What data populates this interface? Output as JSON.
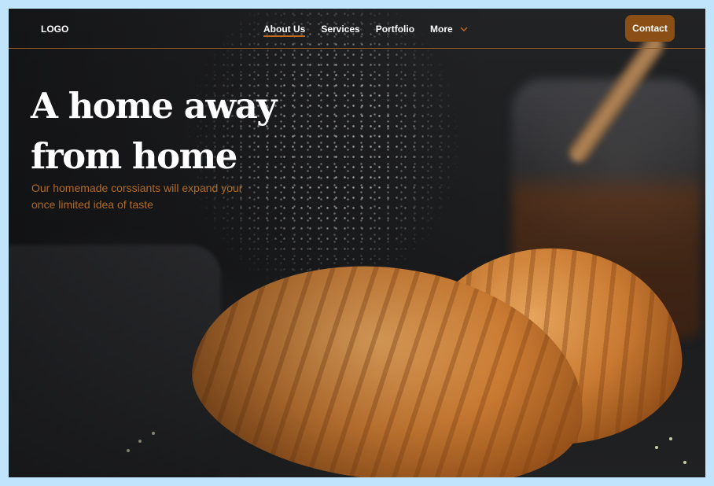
{
  "navbar": {
    "logo": "LOGO",
    "links": [
      {
        "label": "About Us",
        "active": true
      },
      {
        "label": "Services",
        "active": false
      },
      {
        "label": "Portfolio",
        "active": false
      },
      {
        "label": "More",
        "active": false,
        "has_dropdown": true
      }
    ],
    "contact_label": "Contact",
    "chevron_icon": "chevron-down-icon"
  },
  "hero": {
    "title_line1": "A home away",
    "title_line2": "from home",
    "subtitle_line1": "Our homemade corssiants will expand your",
    "subtitle_line2": "once limited idea of taste",
    "background_image": "croissants-dusted-with-powdered-sugar"
  },
  "colors": {
    "accent": "#8b4f15",
    "subtitle": "#b06a26",
    "nav_underline": "#c46a1e",
    "divider": "#8a5a2b",
    "frame_border": "#bfe4fb"
  }
}
